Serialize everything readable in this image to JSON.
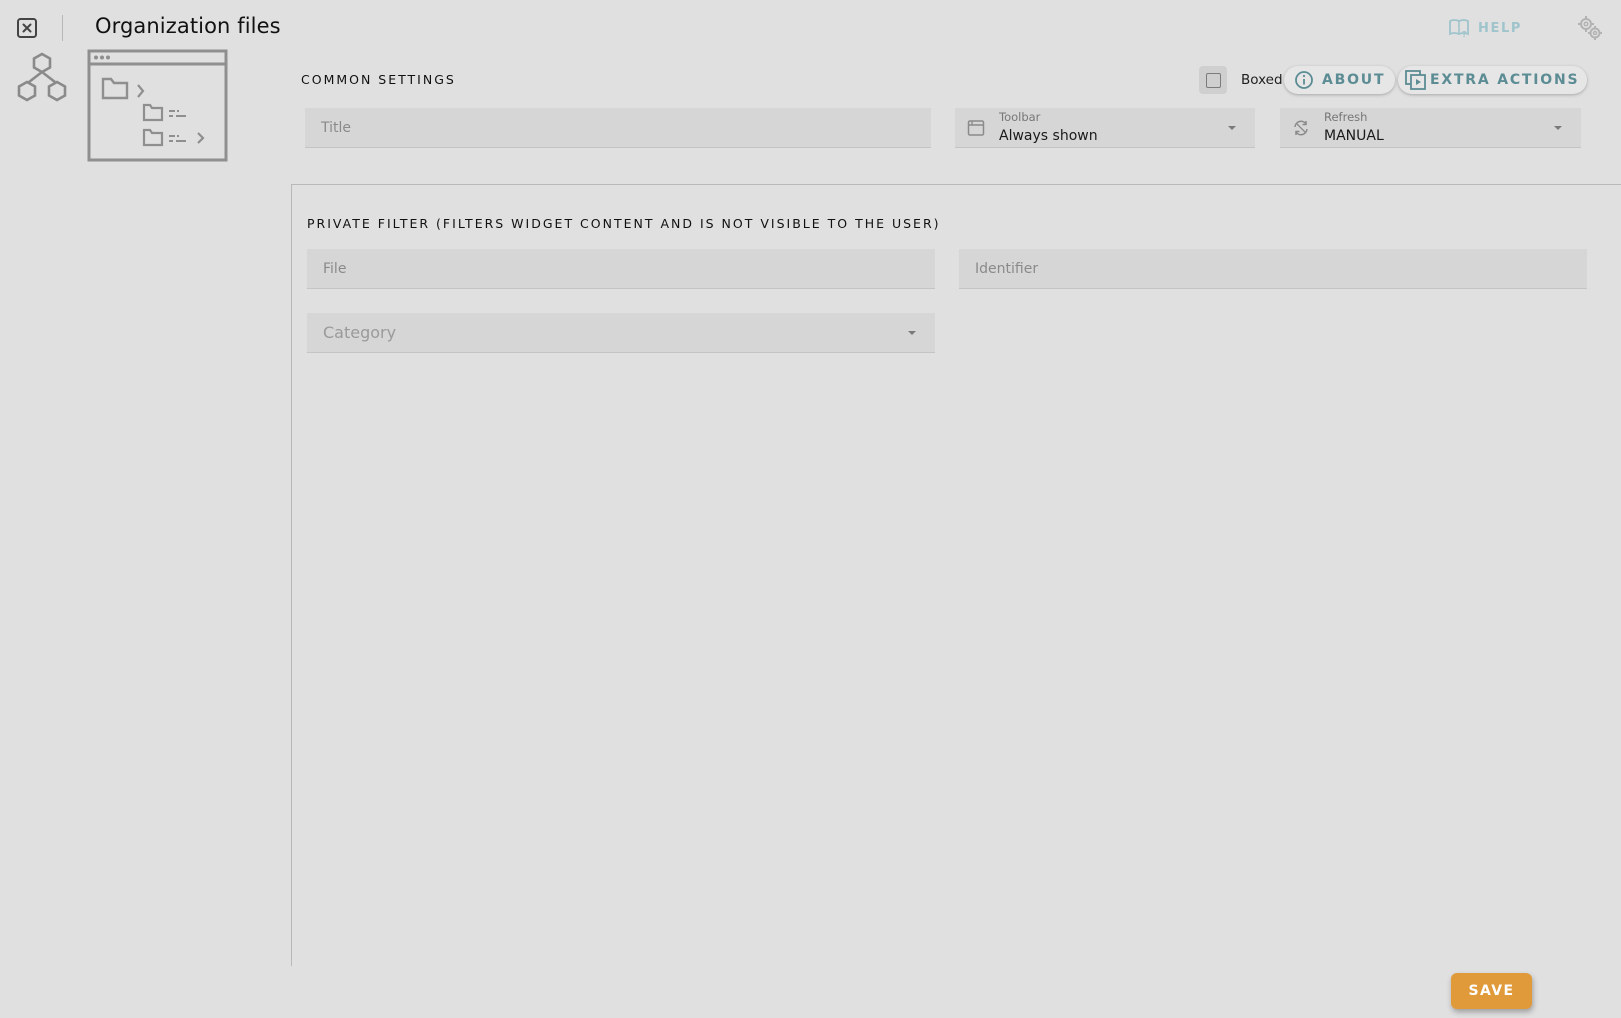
{
  "header": {
    "title": "Organization files",
    "help_label": "HELP"
  },
  "common_settings": {
    "heading": "COMMON SETTINGS",
    "boxed_label": "Boxed",
    "about_label": "ABOUT",
    "extra_actions_label": "EXTRA ACTIONS",
    "title_placeholder": "Title",
    "toolbar": {
      "label": "Toolbar",
      "value": "Always shown"
    },
    "refresh": {
      "label": "Refresh",
      "value": "MANUAL"
    }
  },
  "private_filter": {
    "heading": "PRIVATE FILTER (FILTERS WIDGET CONTENT AND IS NOT VISIBLE TO THE USER)",
    "file_placeholder": "File",
    "identifier_placeholder": "Identifier",
    "category_placeholder": "Category"
  },
  "footer": {
    "save_label": "SAVE"
  },
  "colors": {
    "background": "#e0e0e0",
    "accent_teal": "#5c8c94",
    "help_color": "#9fc4cc",
    "save_button": "#e09a3a"
  }
}
